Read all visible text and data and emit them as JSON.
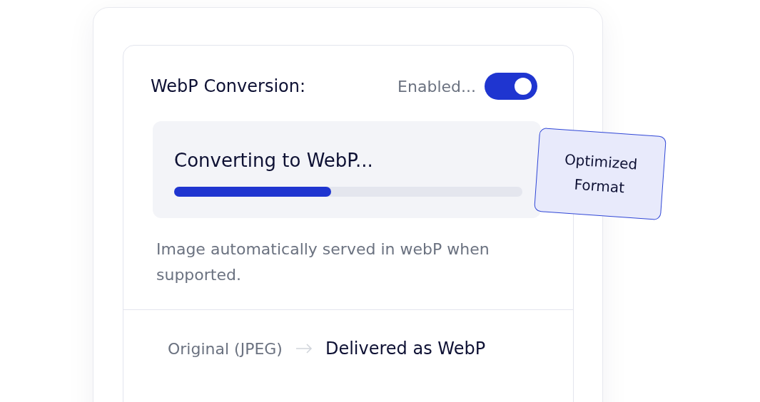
{
  "header": {
    "title": "WebP Conversion:",
    "status": "Enabled...",
    "toggle": {
      "on": true
    }
  },
  "progress": {
    "label": "Converting to WebP...",
    "level": 0.45
  },
  "badge": {
    "lines": [
      "Optimized",
      "Format"
    ]
  },
  "description": "Image automatically served in webP when supported.",
  "footer": {
    "from": "Original (JPEG)",
    "to": "Delivered as WebP"
  }
}
